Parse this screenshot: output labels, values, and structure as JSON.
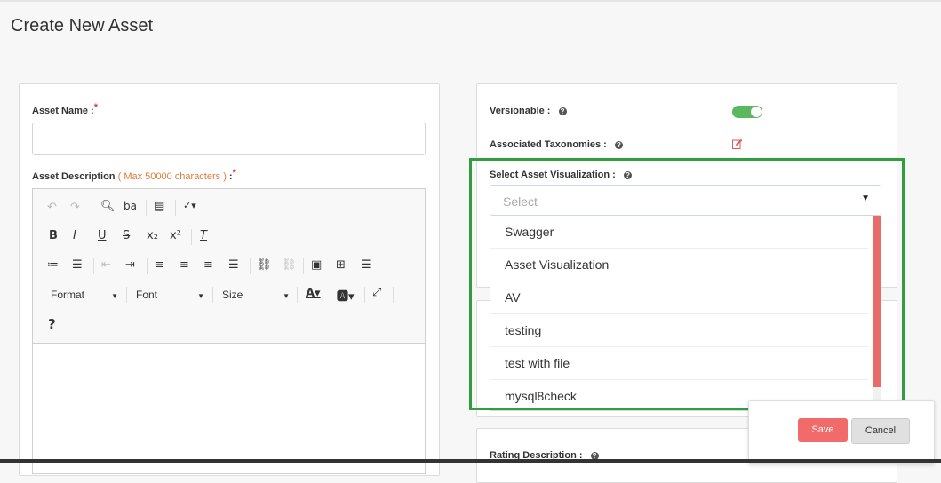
{
  "page": {
    "title": "Create New Asset"
  },
  "left_card": {
    "asset_name_label": "Asset Name :",
    "required_mark": "*",
    "asset_name_value": "",
    "description_label": "Asset Description",
    "description_hint": "( Max 50000 characters )",
    "description_colon": " :",
    "editor": {
      "format_label": "Format",
      "font_label": "Font",
      "size_label": "Size",
      "help_glyph": "?"
    }
  },
  "right_card": {
    "versionable_label": "Versionable :",
    "versionable_on": true,
    "taxonomies_label": "Associated Taxonomies :",
    "visualization_label": "Select Asset Visualization :",
    "visualization_placeholder": "Select",
    "visualization_options": [
      "Swagger",
      "Asset Visualization",
      "AV",
      "testing",
      "test with file",
      "mysql8check"
    ],
    "rating_description_label": "Rating Description :"
  },
  "actions": {
    "save_label": "Save",
    "cancel_label": "Cancel"
  },
  "colors": {
    "accent_red": "#f26b6b",
    "toggle_green": "#5cb85c",
    "highlight_green": "#2e9e3e"
  }
}
